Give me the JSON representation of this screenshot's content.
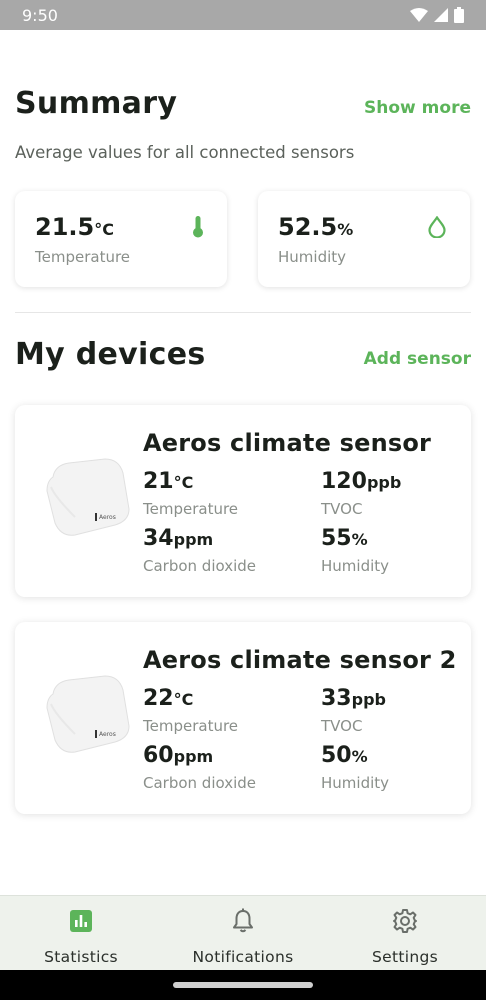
{
  "status_bar": {
    "time": "9:50"
  },
  "summary": {
    "title": "Summary",
    "show_more": "Show more",
    "subtitle": "Average values for all connected sensors",
    "cards": [
      {
        "value": "21.5",
        "unit": "°C",
        "label": "Temperature",
        "icon": "thermometer-icon"
      },
      {
        "value": "52.5",
        "unit": "%",
        "label": "Humidity",
        "icon": "droplet-icon"
      }
    ]
  },
  "devices": {
    "title": "My devices",
    "add_sensor": "Add sensor",
    "items": [
      {
        "name": "Aeros climate sensor",
        "metrics": [
          {
            "value": "21",
            "unit": "°C",
            "label": "Temperature"
          },
          {
            "value": "120",
            "unit": "ppb",
            "label": "TVOC"
          },
          {
            "value": "34",
            "unit": "ppm",
            "label": "Carbon dioxide"
          },
          {
            "value": "55",
            "unit": "%",
            "label": "Humidity"
          }
        ]
      },
      {
        "name": "Aeros climate sensor 2",
        "metrics": [
          {
            "value": "22",
            "unit": "°C",
            "label": "Temperature"
          },
          {
            "value": "33",
            "unit": "ppb",
            "label": "TVOC"
          },
          {
            "value": "60",
            "unit": "ppm",
            "label": "Carbon dioxide"
          },
          {
            "value": "50",
            "unit": "%",
            "label": "Humidity"
          }
        ]
      }
    ]
  },
  "nav": {
    "items": [
      {
        "label": "Statistics",
        "icon": "bar-chart-icon",
        "active": true
      },
      {
        "label": "Notifications",
        "icon": "bell-icon",
        "active": false
      },
      {
        "label": "Settings",
        "icon": "gear-icon",
        "active": false
      }
    ]
  },
  "colors": {
    "accent": "#5cb45a",
    "nav_background": "#eef2ec"
  }
}
